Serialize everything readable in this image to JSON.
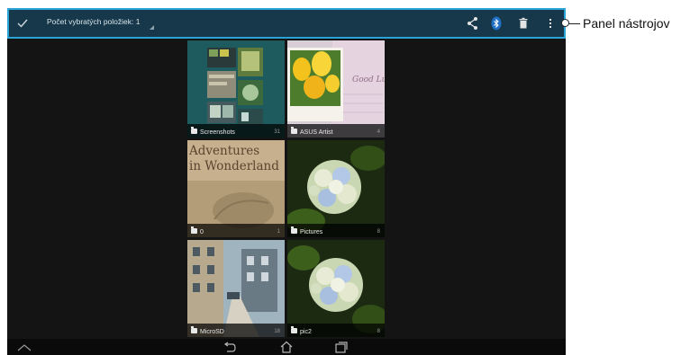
{
  "action_bar": {
    "done_icon": "checkmark-icon",
    "title": "Počet vybratých položiek: 1",
    "share_icon": "share-icon",
    "bluetooth_icon": "bluetooth-icon",
    "delete_icon": "trash-icon",
    "overflow_icon": "overflow-menu-icon",
    "accent": "#2aa4d6",
    "background": "#16384a"
  },
  "annotation": {
    "label": "Panel nástrojov"
  },
  "albums": [
    {
      "name": "Screenshots",
      "count": "31",
      "selected": true,
      "thumb": "screenshots-thumbnail"
    },
    {
      "name": "ASUS Artist",
      "count": "4",
      "selected": false,
      "thumb": "tulips-thumbnail"
    },
    {
      "name": "0",
      "count": "1",
      "selected": false,
      "thumb": "book-thumbnail",
      "cover_text": "Adventures in Wonderland"
    },
    {
      "name": "Pictures",
      "count": "8",
      "selected": false,
      "thumb": "hydrangea-thumbnail"
    },
    {
      "name": "MicroSD",
      "count": "18",
      "selected": false,
      "thumb": "street-thumbnail"
    },
    {
      "name": "pic2",
      "count": "8",
      "selected": false,
      "thumb": "hydrangea-thumbnail"
    }
  ],
  "nav_bar": {
    "up_icon": "chevron-up-icon",
    "back_icon": "back-icon",
    "home_icon": "home-icon",
    "recents_icon": "recent-apps-icon"
  }
}
